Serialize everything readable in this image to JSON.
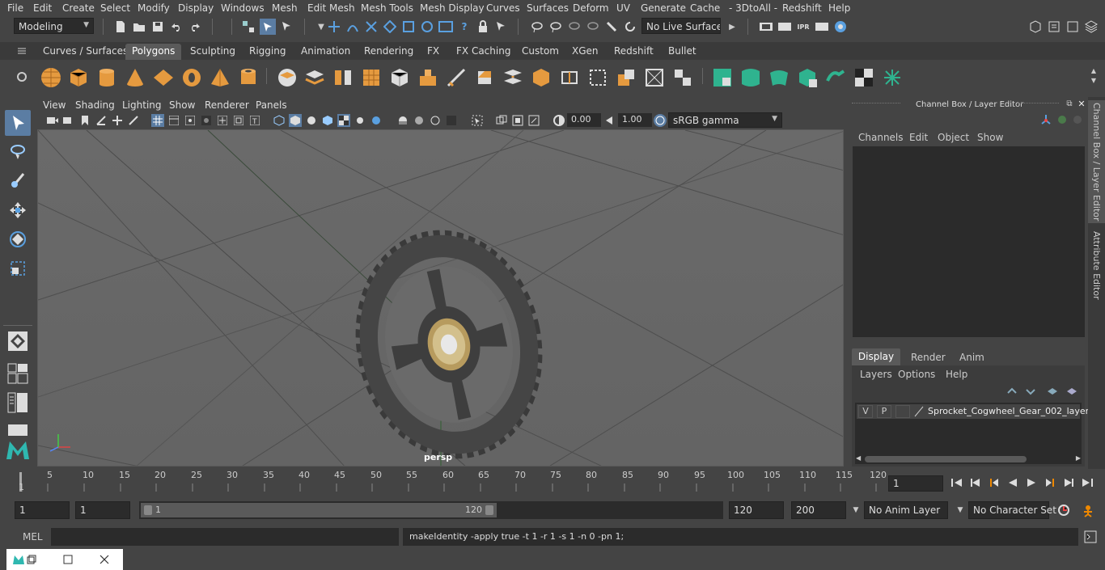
{
  "menubar": {
    "items": [
      "File",
      "Edit",
      "Create",
      "Select",
      "Modify",
      "Display",
      "Windows",
      "Mesh",
      "Edit Mesh",
      "Mesh Tools",
      "Mesh Display",
      "Curves",
      "Surfaces",
      "Deform",
      "UV",
      "Generate",
      "Cache",
      "- 3DtoAll -",
      "Redshift",
      "Help"
    ]
  },
  "status": {
    "mode": "Modeling",
    "live_surface": "No Live Surface"
  },
  "shelf": {
    "tabs": [
      "Curves / Surfaces",
      "Polygons",
      "Sculpting",
      "Rigging",
      "Animation",
      "Rendering",
      "FX",
      "FX Caching",
      "Custom",
      "XGen",
      "Redshift",
      "Bullet"
    ],
    "active_tab": "Polygons"
  },
  "viewport": {
    "menus": [
      "View",
      "Shading",
      "Lighting",
      "Show",
      "Renderer",
      "Panels"
    ],
    "exposure": "0.00",
    "gamma": "1.00",
    "color_space": "sRGB gamma",
    "camera_label": "persp"
  },
  "channel_box": {
    "title": "Channel Box / Layer Editor",
    "menus": [
      "Channels",
      "Edit",
      "Object",
      "Show"
    ]
  },
  "layer_editor": {
    "tabs": [
      "Display",
      "Render",
      "Anim"
    ],
    "active_tab": "Display",
    "menus": [
      "Layers",
      "Options",
      "Help"
    ],
    "layer": {
      "v": "V",
      "p": "P",
      "name": "Sprocket_Cogwheel_Gear_002_layer"
    }
  },
  "side_tabs": [
    "Channel Box / Layer Editor",
    "Attribute Editor"
  ],
  "timeline": {
    "ticks": [
      "5",
      "10",
      "15",
      "20",
      "25",
      "30",
      "35",
      "40",
      "45",
      "50",
      "55",
      "60",
      "65",
      "70",
      "75",
      "80",
      "85",
      "90",
      "95",
      "100",
      "105",
      "110",
      "115",
      "120"
    ],
    "start_marker": "1",
    "current_frame": "1"
  },
  "range": {
    "start": "1",
    "start_inner": "1",
    "slider_min": "1",
    "slider_max": "120",
    "end_inner": "120",
    "end": "200",
    "anim_layer": "No Anim Layer",
    "character_set": "No Character Set"
  },
  "command": {
    "lang": "MEL",
    "output": "makeIdentity -apply true -t 1 -r 1 -s 1 -n 0 -pn 1;"
  }
}
